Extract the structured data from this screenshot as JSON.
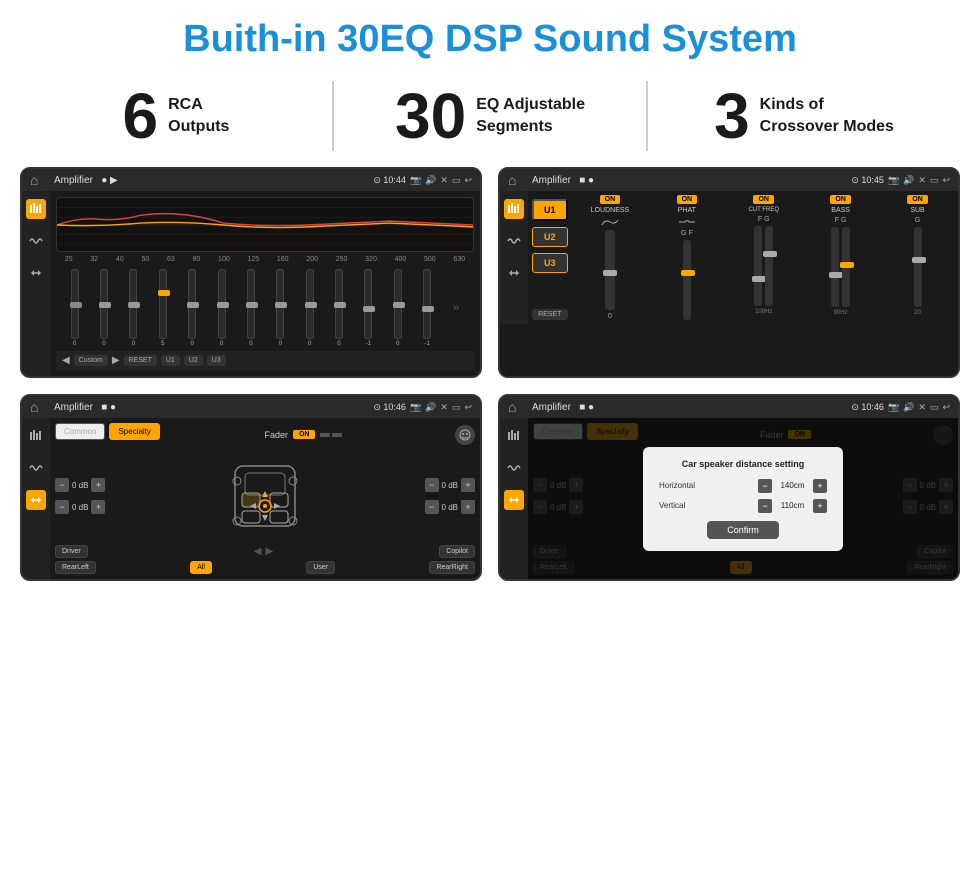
{
  "header": {
    "title": "Buith-in 30EQ DSP Sound System"
  },
  "stats": [
    {
      "number": "6",
      "text": "RCA\nOutputs"
    },
    {
      "number": "30",
      "text": "EQ Adjustable\nSegments"
    },
    {
      "number": "3",
      "text": "Kinds of\nCrossover Modes"
    }
  ],
  "screens": [
    {
      "id": "screen1",
      "title": "Amplifier",
      "time": "10:44",
      "type": "eq",
      "eq_freqs": [
        "25",
        "32",
        "40",
        "50",
        "63",
        "80",
        "100",
        "125",
        "160",
        "200",
        "250",
        "320",
        "400",
        "500",
        "630"
      ],
      "eq_values": [
        "0",
        "0",
        "0",
        "5",
        "0",
        "0",
        "0",
        "0",
        "0",
        "0",
        "-1",
        "0",
        "-1"
      ],
      "bottom_btns": [
        "Custom",
        "RESET",
        "U1",
        "U2",
        "U3"
      ]
    },
    {
      "id": "screen2",
      "title": "Amplifier",
      "time": "10:45",
      "type": "crossover",
      "u_buttons": [
        "U1",
        "U2",
        "U3"
      ],
      "channels": [
        {
          "on": true,
          "label": "LOUDNESS"
        },
        {
          "on": true,
          "label": "PHAT"
        },
        {
          "on": true,
          "label": "CUT FREQ"
        },
        {
          "on": true,
          "label": "BASS"
        },
        {
          "on": true,
          "label": "SUB"
        }
      ],
      "reset_btn": "RESET"
    },
    {
      "id": "screen3",
      "title": "Amplifier",
      "time": "10:46",
      "type": "fader",
      "tabs": [
        "Common",
        "Specialty"
      ],
      "fader_label": "Fader",
      "on_badge": "ON",
      "db_rows": [
        {
          "value": "0 dB"
        },
        {
          "value": "0 dB"
        },
        {
          "value": "0 dB"
        },
        {
          "value": "0 dB"
        }
      ],
      "bottom_btns": [
        "Driver",
        "",
        "Copilot",
        "RearLeft",
        "All",
        "User",
        "RearRight"
      ]
    },
    {
      "id": "screen4",
      "title": "Amplifier",
      "time": "10:46",
      "type": "fader_dialog",
      "tabs": [
        "Common",
        "Specialty"
      ],
      "dialog": {
        "title": "Car speaker distance setting",
        "rows": [
          {
            "label": "Horizontal",
            "value": "140cm"
          },
          {
            "label": "Vertical",
            "value": "110cm"
          }
        ],
        "confirm_btn": "Confirm"
      },
      "db_values": [
        "0 dB",
        "0 dB"
      ],
      "bottom_btns": [
        "Driver",
        "Copilot",
        "RearLeft",
        "RearRight"
      ]
    }
  ],
  "icons": {
    "home": "⌂",
    "back": "↩",
    "settings": "⚙",
    "pin": "📍",
    "volume": "🔊",
    "eq_icon": "≋",
    "wave_icon": "〰",
    "arrows_icon": "⇔"
  },
  "colors": {
    "accent": "#ffa500",
    "blue": "#1a90d9",
    "bg_dark": "#1a1a1a",
    "bg_mid": "#222222",
    "text_light": "#cccccc",
    "text_dim": "#888888"
  }
}
